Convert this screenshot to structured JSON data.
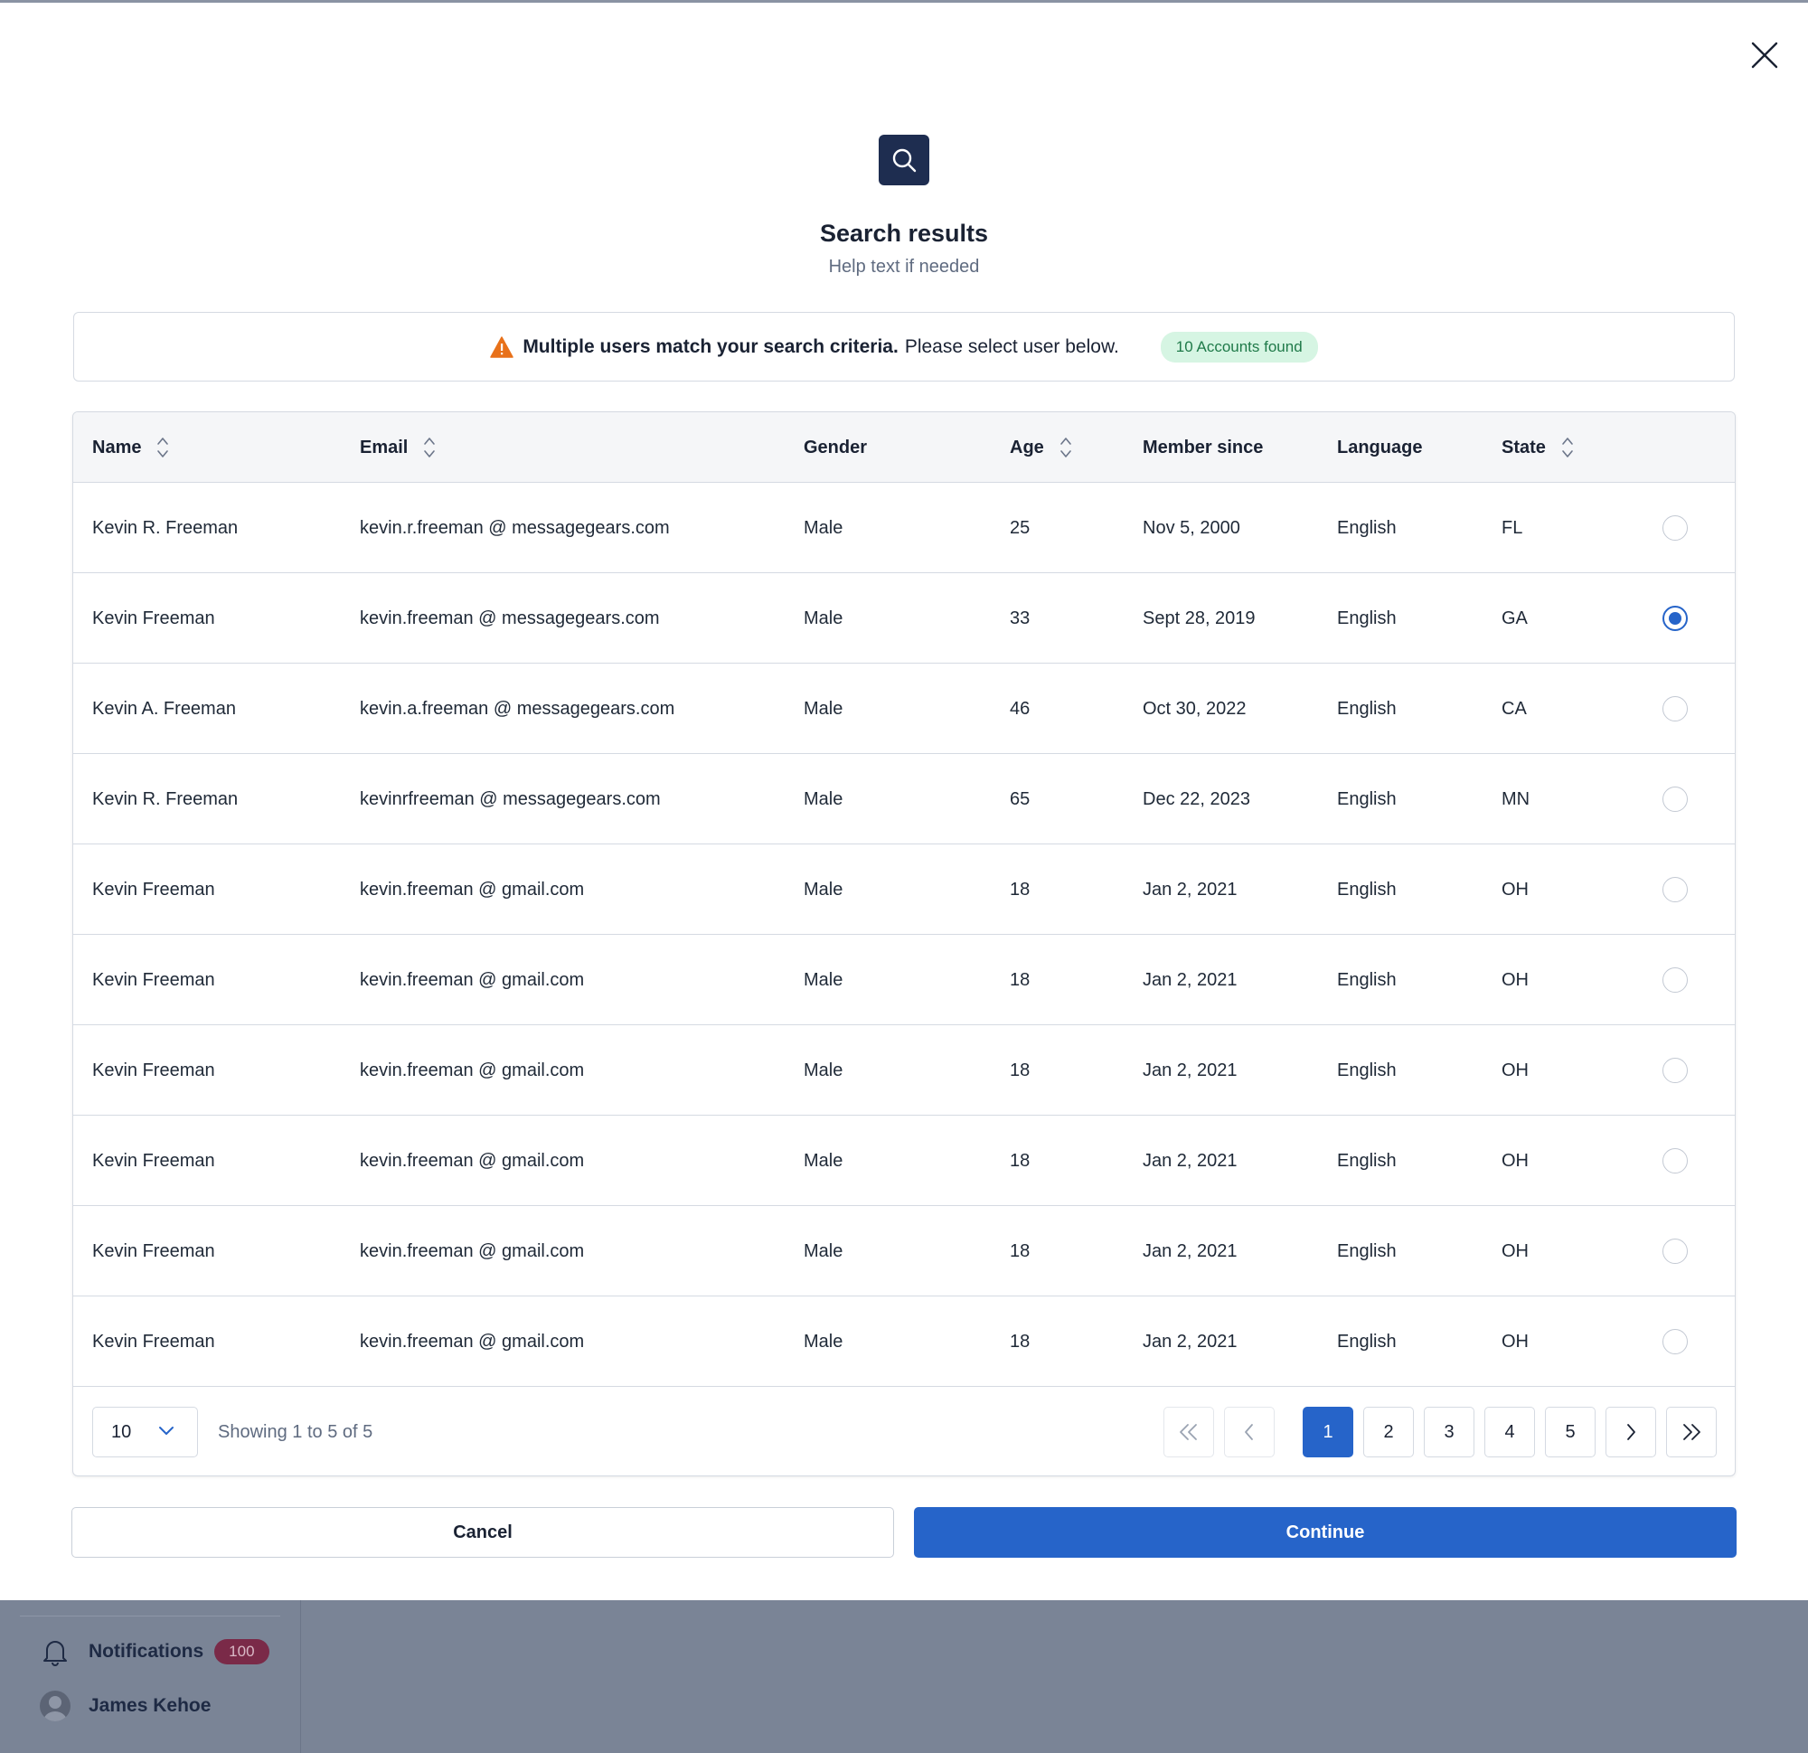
{
  "modal": {
    "title": "Search results",
    "subtitle": "Help text if needed",
    "alert": {
      "bold": "Multiple users match your search criteria.",
      "text": "Please select user below.",
      "badge": "10 Accounts found"
    },
    "columns": [
      "Name",
      "Email",
      "Gender",
      "Age",
      "Member since",
      "Language",
      "State"
    ],
    "rows": [
      {
        "name": "Kevin R. Freeman",
        "email": "kevin.r.freeman @ messagegears.com",
        "gender": "Male",
        "age": "25",
        "member_since": "Nov 5, 2000",
        "language": "English",
        "state": "FL",
        "selected": false
      },
      {
        "name": "Kevin Freeman",
        "email": "kevin.freeman @ messagegears.com",
        "gender": "Male",
        "age": "33",
        "member_since": "Sept 28, 2019",
        "language": "English",
        "state": "GA",
        "selected": true
      },
      {
        "name": "Kevin A. Freeman",
        "email": "kevin.a.freeman @ messagegears.com",
        "gender": "Male",
        "age": "46",
        "member_since": "Oct 30, 2022",
        "language": "English",
        "state": "CA",
        "selected": false
      },
      {
        "name": "Kevin R. Freeman",
        "email": "kevinrfreeman @ messagegears.com",
        "gender": "Male",
        "age": "65",
        "member_since": "Dec 22, 2023",
        "language": "English",
        "state": "MN",
        "selected": false
      },
      {
        "name": "Kevin Freeman",
        "email": "kevin.freeman @ gmail.com",
        "gender": "Male",
        "age": "18",
        "member_since": "Jan 2, 2021",
        "language": "English",
        "state": "OH",
        "selected": false
      },
      {
        "name": "Kevin Freeman",
        "email": "kevin.freeman @ gmail.com",
        "gender": "Male",
        "age": "18",
        "member_since": "Jan 2, 2021",
        "language": "English",
        "state": "OH",
        "selected": false
      },
      {
        "name": "Kevin Freeman",
        "email": "kevin.freeman @ gmail.com",
        "gender": "Male",
        "age": "18",
        "member_since": "Jan 2, 2021",
        "language": "English",
        "state": "OH",
        "selected": false
      },
      {
        "name": "Kevin Freeman",
        "email": "kevin.freeman @ gmail.com",
        "gender": "Male",
        "age": "18",
        "member_since": "Jan 2, 2021",
        "language": "English",
        "state": "OH",
        "selected": false
      },
      {
        "name": "Kevin Freeman",
        "email": "kevin.freeman @ gmail.com",
        "gender": "Male",
        "age": "18",
        "member_since": "Jan 2, 2021",
        "language": "English",
        "state": "OH",
        "selected": false
      },
      {
        "name": "Kevin Freeman",
        "email": "kevin.freeman @ gmail.com",
        "gender": "Male",
        "age": "18",
        "member_since": "Jan 2, 2021",
        "language": "English",
        "state": "OH",
        "selected": false
      }
    ],
    "pagination": {
      "page_size": "10",
      "showing": "Showing 1 to 5 of 5",
      "pages": [
        "1",
        "2",
        "3",
        "4",
        "5"
      ],
      "current_page": "1"
    },
    "cancel_label": "Cancel",
    "continue_label": "Continue"
  },
  "background": {
    "notifications_label": "Notifications",
    "notifications_count": "100",
    "user_name": "James Kehoe"
  },
  "colors": {
    "primary": "#2664c9",
    "icon_badge": "#1e2d50",
    "warning": "#e8711a",
    "success_bg": "#d6f5e3",
    "success_text": "#1f7a49",
    "overlay": "#7a8496"
  },
  "icons": {
    "close": "close-icon",
    "search": "search-icon",
    "warning": "warning-icon",
    "sort": "sort-icon",
    "chevron_down": "chevron-down-icon",
    "first": "chevrons-left-icon",
    "prev": "chevron-left-icon",
    "next": "chevron-right-icon",
    "last": "chevrons-right-icon",
    "bell": "bell-icon"
  }
}
